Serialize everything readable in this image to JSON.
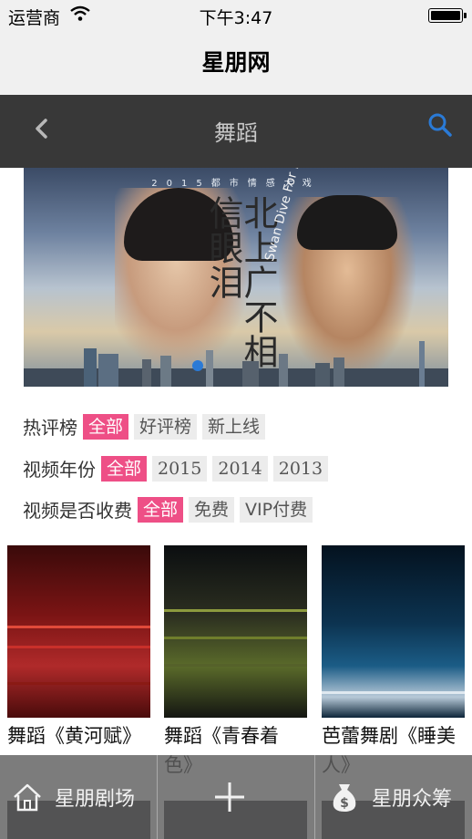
{
  "status_bar": {
    "carrier": "运营商",
    "time": "下午3:47"
  },
  "app_title": "星朋网",
  "nav": {
    "title": "舞蹈"
  },
  "banner": {
    "tagline": "2015都市情感大戏",
    "calligraphy": "北上广不相信眼泪",
    "subtitle": "Swan Dive For Love"
  },
  "filters": [
    {
      "label": "热评榜",
      "options": [
        "全部",
        "好评榜",
        "新上线"
      ],
      "active": 0
    },
    {
      "label": "视频年份",
      "options": [
        "全部",
        "2015",
        "2014",
        "2013"
      ],
      "active": 0
    },
    {
      "label": "视频是否收费",
      "options": [
        "全部",
        "免费",
        "VIP付费"
      ],
      "active": 0
    }
  ],
  "videos": [
    {
      "title": "舞蹈《黄河赋》"
    },
    {
      "title": "舞蹈《青春着色》"
    },
    {
      "title": "芭蕾舞剧《睡美人》"
    }
  ],
  "tabbar": {
    "left_label": "星朋剧场",
    "right_label": "星朋众筹"
  },
  "colors": {
    "accent_pink": "#ee4f86",
    "nav_dark": "#383838",
    "search_blue": "#2a7ad6"
  }
}
